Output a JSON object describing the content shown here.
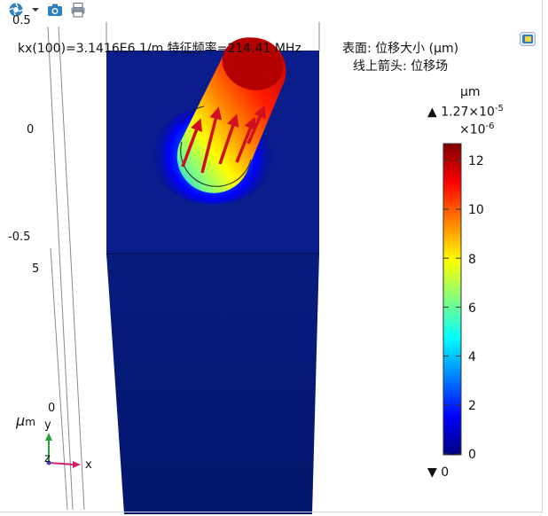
{
  "toolbar": {
    "icons": [
      "zoom-extents-icon",
      "dropdown-chevron-icon",
      "camera-icon",
      "print-icon"
    ]
  },
  "header": {
    "line1_left": "kx(100)=3.1416E6 1/m 特征频率=214.41 MHz",
    "line1_right": "表面: 位移大小 (μm)",
    "line2": "线上箭头: 位移场"
  },
  "axis": {
    "ticks": [
      "0.5",
      "0",
      "-0.5",
      "5",
      "0"
    ],
    "unit_mu": "μ",
    "unit_m": "m"
  },
  "triad": {
    "y": "y",
    "z": "z",
    "x": "x"
  },
  "colorbar": {
    "unit": "μm",
    "max_marker": "▲",
    "max_value_base": "1.27×10",
    "max_value_exp": "-5",
    "scale_base": "×10",
    "scale_exp": "-6",
    "ticks": [
      "12",
      "10",
      "8",
      "6",
      "4",
      "2",
      "0"
    ],
    "min_marker": "▼",
    "min_value": "0",
    "colors": [
      "#7f0000",
      "#ff0000",
      "#ff8000",
      "#ffff00",
      "#80ff80",
      "#00ffff",
      "#0080ff",
      "#0000ff",
      "#00007f"
    ]
  },
  "colors": {
    "background_blue": "#00108a",
    "arrow_red": "#d01020",
    "toolbar_icon": "#2f7fc1"
  }
}
